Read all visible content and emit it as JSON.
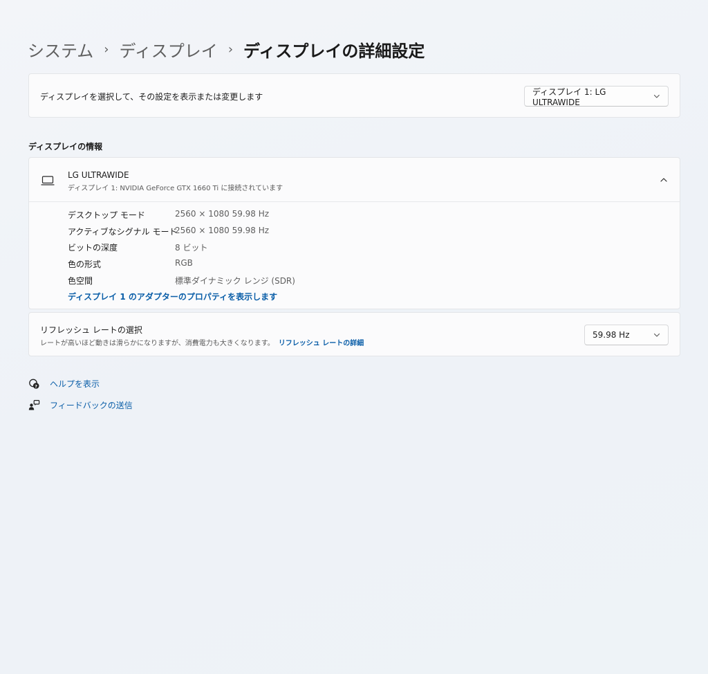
{
  "breadcrumb": {
    "items": [
      "システム",
      "ディスプレイ"
    ],
    "current": "ディスプレイの詳細設定",
    "separator": "›"
  },
  "display_select": {
    "description": "ディスプレイを選択して、その設定を表示または変更します",
    "selected": "ディスプレイ 1: LG ULTRAWIDE",
    "icon": "chevron-down-icon"
  },
  "display_info": {
    "section_title": "ディスプレイの情報",
    "name": "LG ULTRAWIDE",
    "subtitle": "ディスプレイ 1: NVIDIA GeForce GTX 1660 Ti に接続されています",
    "icon": "monitor-icon",
    "expand_icon": "chevron-up-icon",
    "rows": [
      {
        "label": "デスクトップ モード",
        "value": "2560 × 1080 59.98 Hz"
      },
      {
        "label": "アクティブなシグナル モード",
        "value": "2560 × 1080 59.98 Hz"
      },
      {
        "label": "ビットの深度",
        "value": "8 ビット"
      },
      {
        "label": "色の形式",
        "value": "RGB"
      },
      {
        "label": "色空間",
        "value": "標準ダイナミック レンジ (SDR)"
      }
    ],
    "adapter_link": "ディスプレイ 1 のアダプターのプロパティを表示します"
  },
  "refresh_rate": {
    "title": "リフレッシュ レートの選択",
    "description": "レートが高いほど動きは滑らかになりますが、消費電力も大きくなります。",
    "link": "リフレッシュ レートの詳細",
    "selected": "59.98 Hz"
  },
  "footer": {
    "help": "ヘルプを表示",
    "feedback": "フィードバックの送信"
  },
  "colors": {
    "link": "#0a5ea8",
    "card_bg": "#fbfbfc",
    "page_bg": "#f0f3f7"
  }
}
